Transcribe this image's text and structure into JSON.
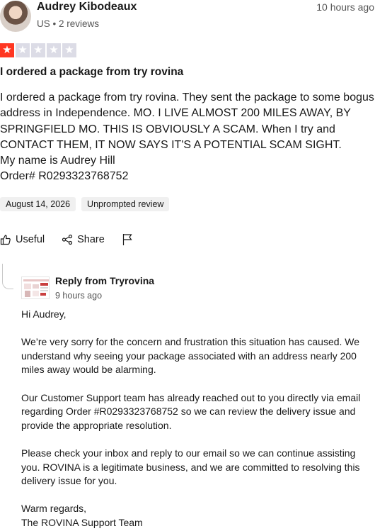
{
  "reviewer": {
    "name": "Audrey Kibodeaux",
    "country": "US",
    "separator": "•",
    "review_count": "2 reviews",
    "posted": "10 hours ago"
  },
  "rating": {
    "value": 1,
    "max": 5,
    "star_color": "#ff3722",
    "empty_color": "#dcdce6"
  },
  "review": {
    "title": "I ordered a package from try rovina",
    "body": [
      "I ordered a package from try rovina. They sent the package to some bogus address in Independence. MO. I LIVE ALMOST 200 MILES AWAY, BY SPRINGFIELD MO. THIS IS OBVIOUSLY A SCAM. When I try and CONTACT THEM, IT NOW SAYS IT'S A POTENTIAL SCAM SIGHT.",
      "My name is Audrey Hill",
      "Order# R0293323768752"
    ],
    "date_chip": "August 14, 2026",
    "type_chip": "Unprompted review"
  },
  "actions": {
    "useful": "Useful",
    "share": "Share"
  },
  "reply": {
    "from": "Reply from Tryrovina",
    "posted": "9 hours ago",
    "greeting": "Hi Audrey,",
    "p1": "We’re very sorry for the concern and frustration this situation has caused. We understand why seeing your package associated with an address nearly 200 miles away would be alarming.",
    "p2": "Our Customer Support team has already reached out to you directly via email regarding Order #R0293323768752 so we can review the delivery issue and provide the appropriate resolution.",
    "p3": "Please check your inbox and reply to our email so we can continue assisting you. ROVINA is a legitimate business, and we are committed to resolving this delivery issue for you.",
    "signoff": "Warm regards,",
    "signature": "The ROVINA Support Team"
  }
}
